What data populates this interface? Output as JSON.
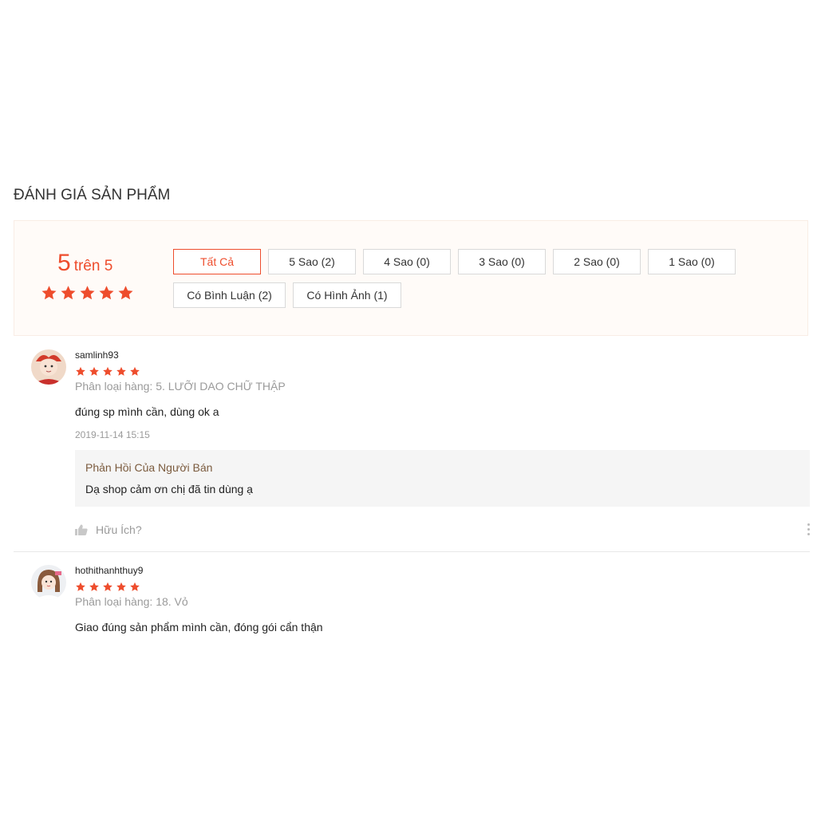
{
  "section_title": "ĐÁNH GIÁ SẢN PHẨM",
  "summary": {
    "score": "5",
    "score_suffix": "trên 5",
    "rating": 5,
    "max_rating": 5
  },
  "filters": [
    "Tất Cả",
    "5 Sao (2)",
    "4 Sao (0)",
    "3 Sao (0)",
    "2 Sao (0)",
    "1 Sao (0)",
    "Có Bình Luận (2)",
    "Có Hình Ảnh (1)"
  ],
  "colors": {
    "accent": "#ee4d2d",
    "reply_title": "#7b5b3e",
    "muted": "#9a9a9a"
  },
  "reviews": [
    {
      "username": "samlinh93",
      "rating": 5,
      "variant": "Phân loại hàng: 5. LƯỠI DAO CHỮ THẬP",
      "comment": "đúng sp mình cần, dùng ok a",
      "date": "2019-11-14 15:15",
      "reply": {
        "title": "Phản Hồi Của Người Bán",
        "text": "Dạ shop cảm ơn chị đã tin dùng ạ"
      },
      "helpful_label": "Hữu Ích?"
    },
    {
      "username": "hothithanhthuy9",
      "rating": 5,
      "variant": "Phân loại hàng: 18. Vỏ",
      "comment": "Giao đúng sản phẩm mình cần, đóng gói cẩn thận"
    }
  ]
}
